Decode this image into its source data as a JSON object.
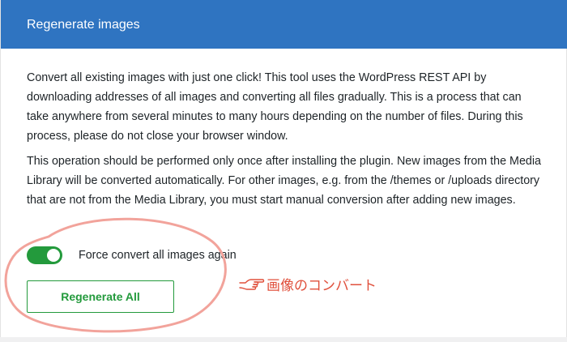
{
  "panel": {
    "title": "Regenerate images",
    "paragraph1": "Convert all existing images with just one click! This tool uses the WordPress REST API by downloading addresses of all images and converting all files gradually. This is a process that can take anywhere from several minutes to many hours depending on the number of files. During this process, please do not close your browser window.",
    "paragraph2": "This operation should be performed only once after installing the plugin. New images from the Media Library will be converted automatically. For other images, e.g. from the /themes or /uploads directory that are not from the Media Library, you must start manual conversion after adding new images."
  },
  "options": {
    "force_convert_label": "Force convert all images again",
    "force_convert_enabled": true
  },
  "actions": {
    "regenerate_label": "Regenerate All"
  },
  "annotation": {
    "text": "画像のコンバート",
    "color": "#e0503c",
    "icon": "pointing-hand-icon"
  },
  "colors": {
    "header": "#2f74c1",
    "accent": "#239a3c"
  }
}
